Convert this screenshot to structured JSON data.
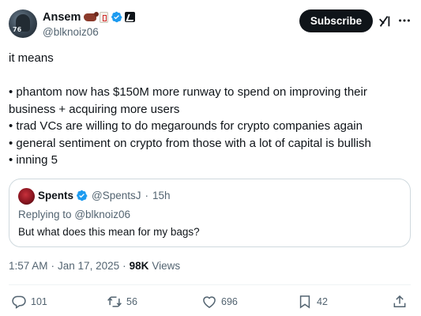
{
  "author": {
    "name": "Ansem",
    "handle": "@blknoiz06",
    "avatar_number": "76"
  },
  "header": {
    "subscribe_label": "Subscribe"
  },
  "tweet": {
    "text": "it means\n\n• phantom now has $150M more runway to spend on improving their business + acquiring more users\n• trad VCs are willing to do megarounds for crypto companies again\n• general sentiment on crypto from those with a lot of capital is bullish\n• inning 5"
  },
  "quote": {
    "name": "Spents",
    "handle": "@SpentsJ",
    "separator": "·",
    "time": "15h",
    "replying_label": "Replying to",
    "replying_handle": "@blknoiz06",
    "text": "But what does this mean for my bags?"
  },
  "meta": {
    "time": "1:57 AM",
    "separator": "·",
    "date": "Jan 17, 2025",
    "separator2": "·",
    "views_count": "98K",
    "views_label": "Views"
  },
  "actions": {
    "reply_count": "101",
    "retweet_count": "56",
    "like_count": "696",
    "bookmark_count": "42"
  },
  "colors": {
    "text_primary": "#0f1419",
    "text_secondary": "#536471",
    "verified_blue": "#1d9bf0",
    "border": "#cfd9de"
  }
}
